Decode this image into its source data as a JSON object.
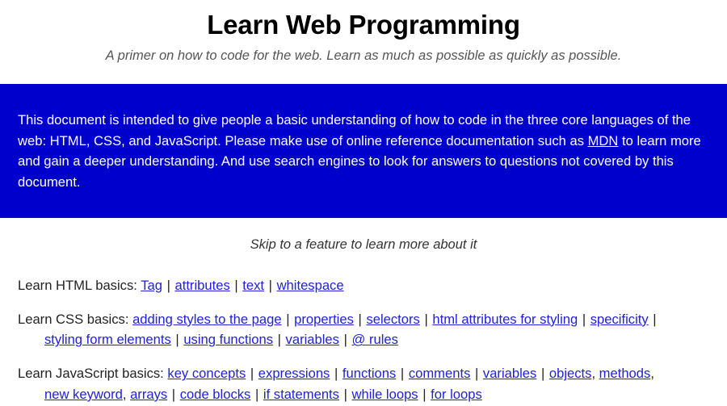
{
  "header": {
    "title": "Learn Web Programming",
    "subtitle": "A primer on how to code for the web. Learn as much as possible as quickly as possible."
  },
  "intro": {
    "background_color": "#0000cc",
    "text_color": "#ffffff",
    "part1": "This document is intended to give people a basic understanding of how to code in the three core languages of the web: HTML, CSS, and JavaScript. Please make use of online reference documentation such as ",
    "link_label": "MDN",
    "part2": " to learn more and gain a deeper understanding. And use search engines to look for answers to questions not covered by this document."
  },
  "skip_note": "Skip to a feature to learn more about it",
  "link_color": "#2020dd",
  "sections": [
    {
      "label": "Learn HTML basics:",
      "items": [
        {
          "text": "Tag",
          "sep_after": "|"
        },
        {
          "text": "attributes",
          "sep_after": "|"
        },
        {
          "text": "text",
          "sep_after": "|"
        },
        {
          "text": "whitespace",
          "sep_after": ""
        }
      ]
    },
    {
      "label": "Learn CSS basics:",
      "items": [
        {
          "text": "adding styles to the page",
          "sep_after": "|"
        },
        {
          "text": "properties",
          "sep_after": "|"
        },
        {
          "text": "selectors",
          "sep_after": "|"
        },
        {
          "text": "html attributes for styling",
          "sep_after": "|"
        },
        {
          "text": "specificity",
          "sep_after": "|"
        },
        {
          "text": "styling form elements",
          "sep_after": "|"
        },
        {
          "text": "using functions",
          "sep_after": "|"
        },
        {
          "text": "variables",
          "sep_after": "|"
        },
        {
          "text": "@ rules",
          "sep_after": ""
        }
      ]
    },
    {
      "label": "Learn JavaScript basics:",
      "items": [
        {
          "text": "key concepts",
          "sep_after": "|"
        },
        {
          "text": "expressions",
          "sep_after": "|"
        },
        {
          "text": "functions",
          "sep_after": "|"
        },
        {
          "text": "comments",
          "sep_after": "|"
        },
        {
          "text": "variables",
          "sep_after": "|"
        },
        {
          "text": "objects",
          "sep_after": ","
        },
        {
          "text": "methods",
          "sep_after": ","
        },
        {
          "text": "new keyword",
          "sep_after": ","
        },
        {
          "text": "arrays",
          "sep_after": "|"
        },
        {
          "text": "code blocks",
          "sep_after": "|"
        },
        {
          "text": "if statements",
          "sep_after": "|"
        },
        {
          "text": "while loops",
          "sep_after": "|"
        },
        {
          "text": "for loops",
          "sep_after": ""
        }
      ]
    }
  ]
}
